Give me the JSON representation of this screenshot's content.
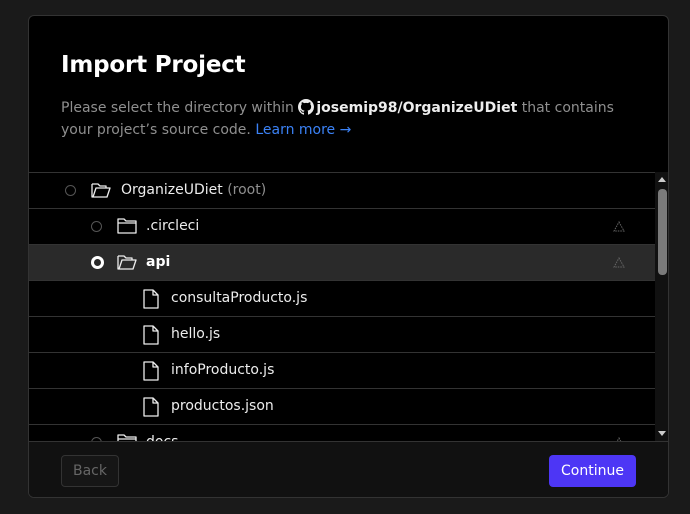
{
  "dialog": {
    "title": "Import Project",
    "desc_prefix": "Please select the directory within",
    "repo": "josemip98/OrganizeUDiet",
    "desc_suffix": "that contains your project’s source code.",
    "learn_more": "Learn more →"
  },
  "tree": {
    "root_name": "OrganizeUDiet",
    "root_note": "(root)",
    "items": [
      {
        "label": "OrganizeUDiet",
        "type": "folder-open"
      },
      {
        "label": ".circleci",
        "type": "folder"
      },
      {
        "label": "api",
        "type": "folder-open",
        "selected": true
      },
      {
        "label": "consultaProducto.js",
        "type": "file"
      },
      {
        "label": "hello.js",
        "type": "file"
      },
      {
        "label": "infoProducto.js",
        "type": "file"
      },
      {
        "label": "productos.json",
        "type": "file"
      },
      {
        "label": "docs",
        "type": "folder"
      }
    ]
  },
  "footer": {
    "back_label": "Back",
    "continue_label": "Continue"
  },
  "colors": {
    "accent": "#4d36f5",
    "link": "#3b82f6",
    "background": "#000000"
  }
}
